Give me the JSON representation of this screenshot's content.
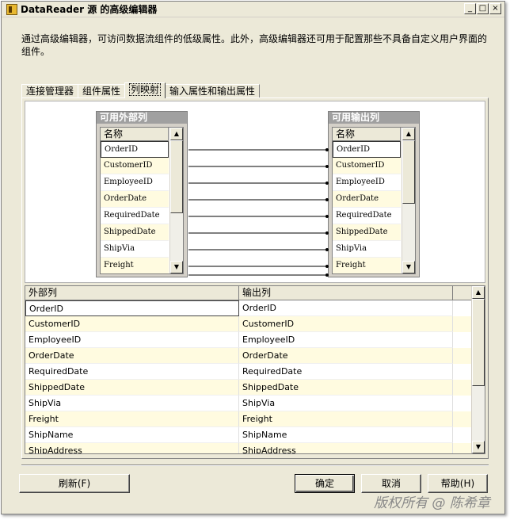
{
  "window": {
    "title": "DataReader 源 的高级编辑器",
    "minimize_label": "_",
    "maximize_label": "□",
    "close_label": "×"
  },
  "description": "通过高级编辑器，可访问数据流组件的低级属性。此外，高级编辑器还可用于配置那些不具备自定义用户界面的组件。",
  "tabs": [
    {
      "label": "连接管理器"
    },
    {
      "label": "组件属性"
    },
    {
      "label": "列映射"
    },
    {
      "label": "输入属性和输出属性"
    }
  ],
  "available_external": {
    "title": "可用外部列",
    "header": "名称",
    "items": [
      "OrderID",
      "CustomerID",
      "EmployeeID",
      "OrderDate",
      "RequiredDate",
      "ShippedDate",
      "ShipVia",
      "Freight"
    ]
  },
  "available_output": {
    "title": "可用输出列",
    "header": "名称",
    "items": [
      "OrderID",
      "CustomerID",
      "EmployeeID",
      "OrderDate",
      "RequiredDate",
      "ShippedDate",
      "ShipVia",
      "Freight"
    ]
  },
  "grid": {
    "headers": [
      "外部列",
      "输出列"
    ],
    "rows": [
      [
        "OrderID",
        "OrderID"
      ],
      [
        "CustomerID",
        "CustomerID"
      ],
      [
        "EmployeeID",
        "EmployeeID"
      ],
      [
        "OrderDate",
        "OrderDate"
      ],
      [
        "RequiredDate",
        "RequiredDate"
      ],
      [
        "ShippedDate",
        "ShippedDate"
      ],
      [
        "ShipVia",
        "ShipVia"
      ],
      [
        "Freight",
        "Freight"
      ],
      [
        "ShipName",
        "ShipName"
      ],
      [
        "ShipAddress",
        "ShipAddress"
      ]
    ]
  },
  "buttons": {
    "refresh": "刷新(F)",
    "ok": "确定",
    "cancel": "取消",
    "help": "帮助(H)"
  },
  "watermark": "版权所有 @ 陈希章",
  "icons": {
    "scroll_up": "▲",
    "scroll_down": "▼"
  }
}
